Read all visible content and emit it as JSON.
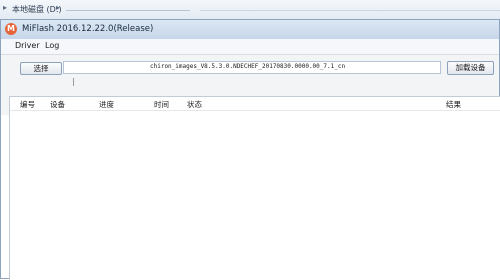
{
  "explorer": {
    "breadcrumb": "本地磁盘 (D:)"
  },
  "window": {
    "title": "MiFlash 2016.12.22.0(Release)",
    "icon_letter": "M"
  },
  "menu": {
    "items": [
      "Driver",
      "Log"
    ]
  },
  "toolbar": {
    "select_label": "选择",
    "path_value": "chiron_images_V8.5.3.0.NDECHEF_20170830.0000.00_7.1_cn",
    "load_label": "加载设备"
  },
  "table": {
    "columns": [
      "编号",
      "设备",
      "进度",
      "时间",
      "状态",
      "结果"
    ]
  }
}
